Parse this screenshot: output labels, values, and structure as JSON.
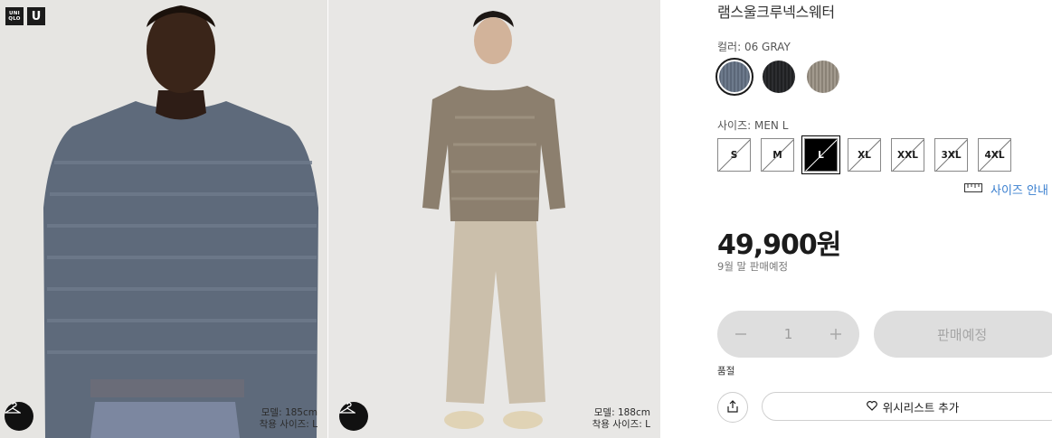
{
  "brand": {
    "logo_uniqlo_lines": [
      "UNI",
      "QLO"
    ],
    "logo_u": "U"
  },
  "gallery": {
    "left": {
      "model_height": "모델: 185cm",
      "model_size": "착용 사이즈: L",
      "icon": "hanger-icon"
    },
    "right": {
      "model_height": "모델: 188cm",
      "model_size": "착용 사이즈: L",
      "icon": "hanger-icon"
    }
  },
  "product": {
    "title": "램스울크루넥스웨터",
    "color_label": "컬러: 06 GRAY",
    "colors": [
      {
        "name": "06 GRAY",
        "hex": "#5b6778",
        "selected": true
      },
      {
        "name": "BLACK",
        "hex": "#232426",
        "selected": false
      },
      {
        "name": "BEIGE",
        "hex": "#8f877c",
        "selected": false
      }
    ],
    "size_label": "사이즈: MEN L",
    "sizes": [
      {
        "label": "S",
        "selected": false,
        "unavailable": true
      },
      {
        "label": "M",
        "selected": false,
        "unavailable": true
      },
      {
        "label": "L",
        "selected": true,
        "unavailable": true
      },
      {
        "label": "XL",
        "selected": false,
        "unavailable": true
      },
      {
        "label": "XXL",
        "selected": false,
        "unavailable": true
      },
      {
        "label": "3XL",
        "selected": false,
        "unavailable": true
      },
      {
        "label": "4XL",
        "selected": false,
        "unavailable": true
      }
    ],
    "size_guide": "사이즈 안내",
    "size_guide_icon": "ruler-icon",
    "price": "49,900원",
    "price_note": "9월 말 판매예정",
    "quantity": "1",
    "minus_icon": "minus-icon",
    "plus_icon": "plus-icon",
    "buy_button": "판매예정",
    "stock_status": "품절",
    "share_icon": "share-icon",
    "wishlist_icon": "heart-icon",
    "wishlist_button": "위시리스트 추가"
  },
  "colors": {
    "accent_link": "#3a7fcf",
    "disabled_bg": "#dedede",
    "text": "#1b1b1b"
  }
}
